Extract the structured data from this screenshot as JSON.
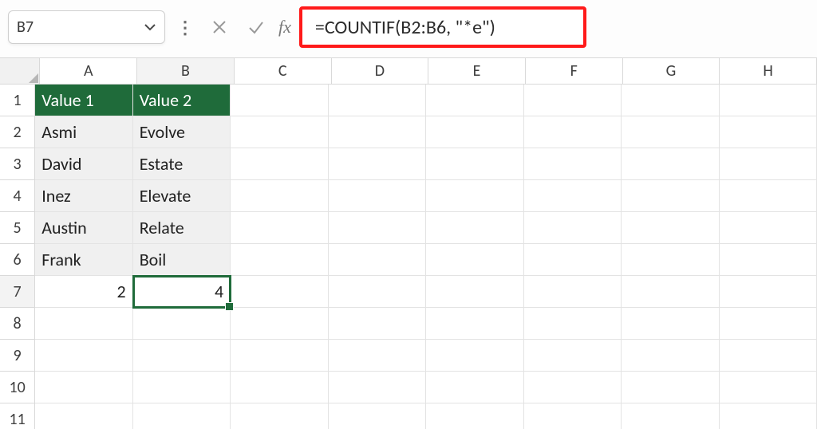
{
  "name_box": {
    "value": "B7"
  },
  "formula_bar": {
    "fx_label": "fx",
    "formula": "=COUNTIF(B2:B6, \"*e\")"
  },
  "columns": [
    "A",
    "B",
    "C",
    "D",
    "E",
    "F",
    "G",
    "H"
  ],
  "row_numbers": [
    "1",
    "2",
    "3",
    "4",
    "5",
    "6",
    "7",
    "8",
    "9",
    "10",
    "11"
  ],
  "headers": {
    "A": "Value 1",
    "B": "Value 2"
  },
  "data": {
    "A": [
      "Asmi",
      "David",
      "Inez",
      "Austin",
      "Frank"
    ],
    "B": [
      "Evolve",
      "Estate",
      "Elevate",
      "Relate",
      "Boil"
    ]
  },
  "results": {
    "A7": "2",
    "B7": "4"
  },
  "selected_cell": "B7",
  "colors": {
    "header_fill": "#1f6b3a",
    "highlight_border": "#ff1a1a"
  }
}
